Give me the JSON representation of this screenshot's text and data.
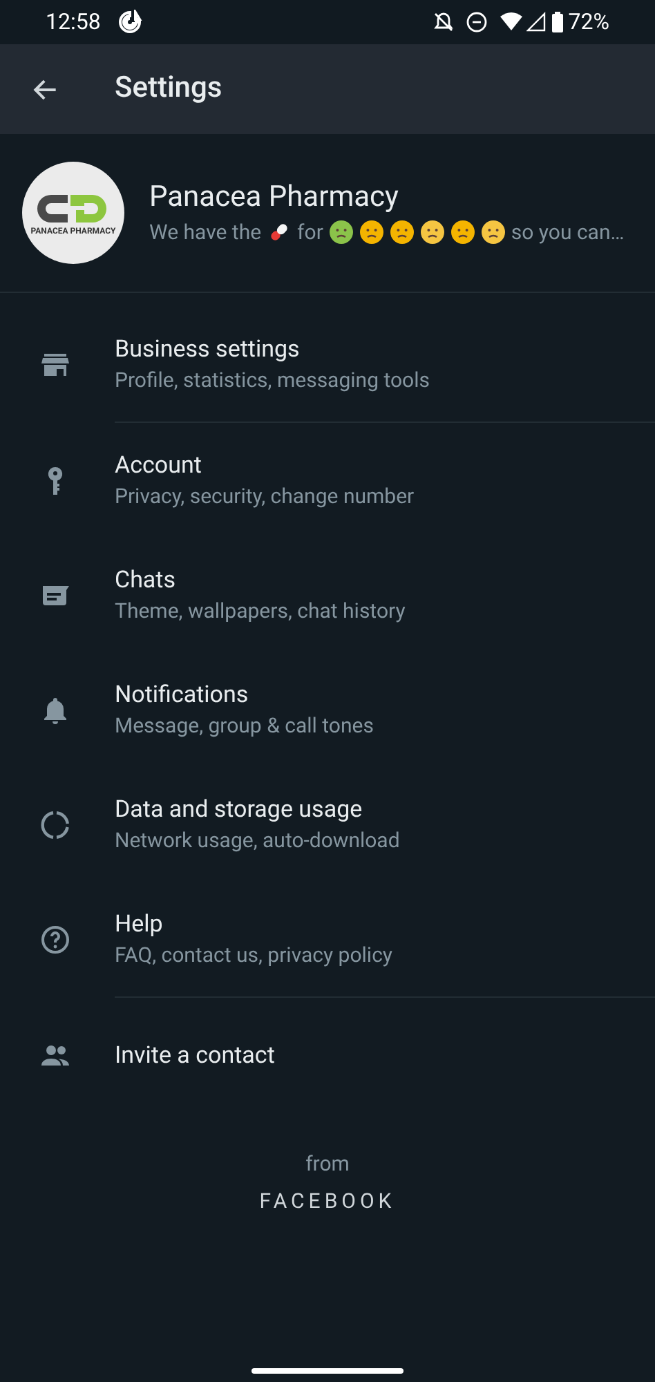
{
  "status_bar": {
    "time": "12:58",
    "battery": "72%"
  },
  "header": {
    "title": "Settings"
  },
  "profile": {
    "name": "Panacea Pharmacy",
    "logo_text": "PANACEA PHARMACY",
    "about": [
      {
        "kind": "text",
        "text": "We have the"
      },
      {
        "kind": "pill"
      },
      {
        "kind": "text",
        "text": "for"
      },
      {
        "kind": "face",
        "color": "#8bc34a"
      },
      {
        "kind": "face",
        "color": "#f4b400"
      },
      {
        "kind": "face",
        "color": "#f4b400"
      },
      {
        "kind": "face",
        "color": "#f5c542"
      },
      {
        "kind": "face",
        "color": "#f4b400"
      },
      {
        "kind": "face",
        "color": "#f5c542"
      },
      {
        "kind": "text",
        "text": "so you can…"
      }
    ]
  },
  "items": [
    {
      "kind": "store",
      "title": "Business settings",
      "subtitle": "Profile, statistics, messaging tools",
      "divider": true
    },
    {
      "kind": "key",
      "title": "Account",
      "subtitle": "Privacy, security, change number",
      "divider": false
    },
    {
      "kind": "chat",
      "title": "Chats",
      "subtitle": "Theme, wallpapers, chat history",
      "divider": false
    },
    {
      "kind": "bell",
      "title": "Notifications",
      "subtitle": "Message, group & call tones",
      "divider": false
    },
    {
      "kind": "data",
      "title": "Data and storage usage",
      "subtitle": "Network usage, auto-download",
      "divider": false
    },
    {
      "kind": "help",
      "title": "Help",
      "subtitle": "FAQ, contact us, privacy policy",
      "divider": true
    },
    {
      "kind": "people",
      "title": "Invite a contact",
      "divider": false
    }
  ],
  "footer": {
    "from": "from",
    "brand": "FACEBOOK"
  }
}
